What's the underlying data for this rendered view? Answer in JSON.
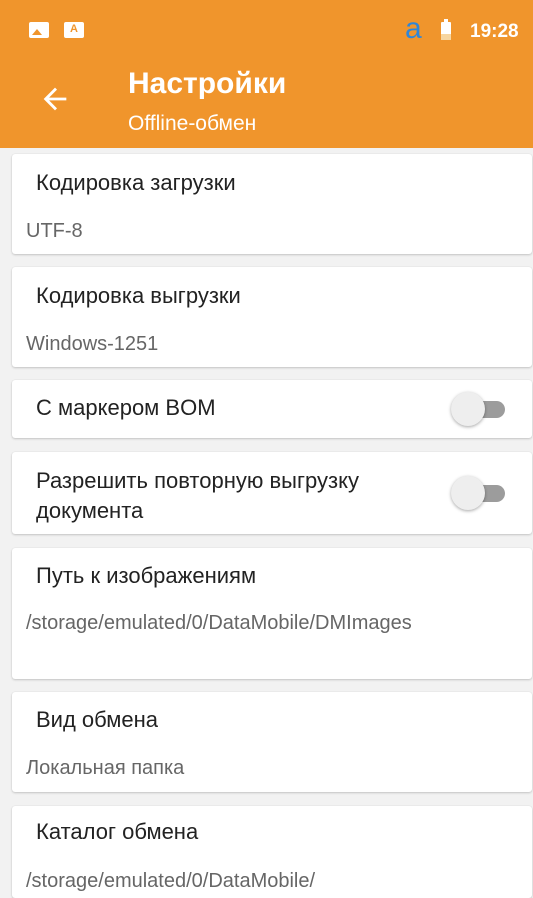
{
  "status_bar": {
    "icons": [
      "image-icon",
      "text-icon",
      "a-icon",
      "battery-icon"
    ],
    "a_glyph": "a",
    "time": "19:28",
    "colors": {
      "a": "#2f86d8"
    }
  },
  "header": {
    "title": "Настройки",
    "subtitle": "Offline-обмен",
    "back_icon": "arrow-left-icon",
    "background": "#f0952c"
  },
  "settings": [
    {
      "title": "Кодировка загрузки",
      "value": "UTF-8"
    },
    {
      "title": "Кодировка выгрузки",
      "value": "Windows-1251"
    },
    {
      "title": "С маркером BOM",
      "toggle": false
    },
    {
      "title": "Разрешить повторную выгрузку документа",
      "toggle": false
    },
    {
      "title": "Путь к изображениям",
      "value": "/storage/emulated/0/DataMobile/DMImages"
    },
    {
      "title": "Вид обмена",
      "value": "Локальная папка"
    },
    {
      "title": "Каталог обмена",
      "value": "/storage/emulated/0/DataMobile/"
    }
  ]
}
